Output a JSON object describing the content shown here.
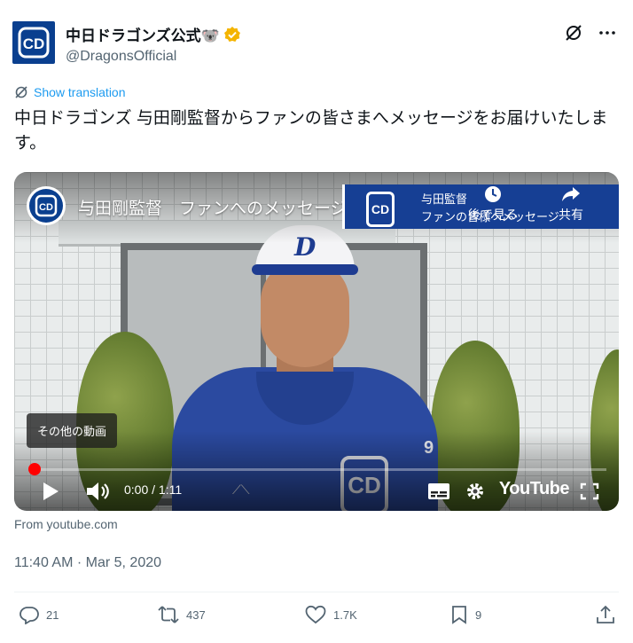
{
  "author": {
    "display_name": "中日ドラゴンズ公式🐨",
    "handle": "@DragonsOfficial",
    "avatar_text": "CD",
    "verified_color": "#f4b400"
  },
  "translation": {
    "label": "Show translation"
  },
  "tweet": {
    "text": "中日ドラゴンズ 与田剛監督からファンの皆さまへメッセージをお届けいたします。"
  },
  "video": {
    "channel_avatar_text": "CD",
    "title": "与田剛監督　ファンへのメッセージ",
    "banner_line1": "与田監督",
    "banner_line2": "ファンの皆様へメッセージ",
    "watch_later_label": "後で見る",
    "share_label": "共有",
    "more_videos_label": "その他の動画",
    "time_display": "0:00 / 1:11",
    "brand_label": "YouTube",
    "cap_letter": "D",
    "jersey_logo": "CD",
    "sleeve_text": "9",
    "progress": 0,
    "accent_color": "#ff0000"
  },
  "source": {
    "label": "From youtube.com"
  },
  "timestamp": "11:40 AM · Mar 5, 2020",
  "actions": {
    "replies": "21",
    "retweets": "437",
    "likes": "1.7K",
    "bookmarks": "9"
  },
  "colors": {
    "link": "#1d9bf0",
    "secondary_text": "#536471",
    "brand_blue": "#0a3f8f"
  }
}
